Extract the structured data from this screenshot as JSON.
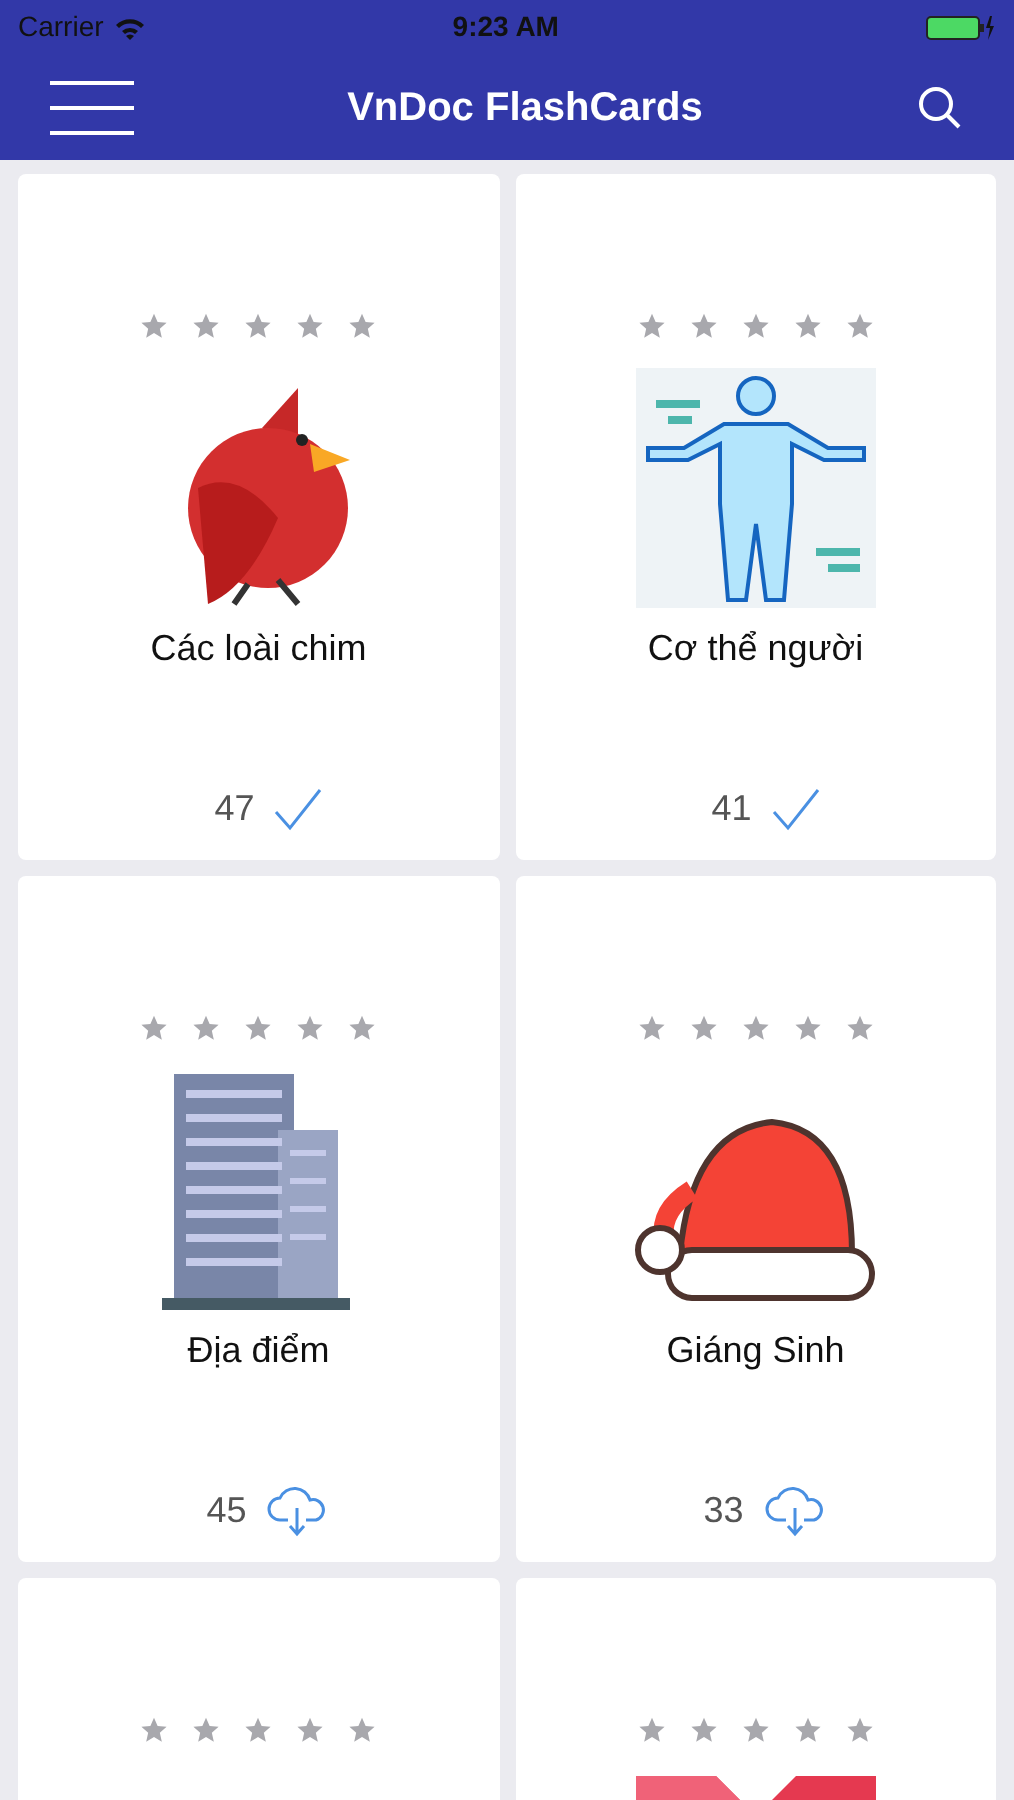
{
  "status_bar": {
    "carrier": "Carrier",
    "time": "9:23 AM"
  },
  "nav": {
    "title": "VnDoc FlashCards"
  },
  "cards": [
    {
      "kind": "bird",
      "stars": 0,
      "title": "Các loài chim",
      "count": "47",
      "downloaded": true
    },
    {
      "kind": "body",
      "stars": 0,
      "title": "Cơ thể người",
      "count": "41",
      "downloaded": true
    },
    {
      "kind": "building",
      "stars": 0,
      "title": "Địa điểm",
      "count": "45",
      "downloaded": false
    },
    {
      "kind": "hat",
      "stars": 0,
      "title": "Giáng Sinh",
      "count": "33",
      "downloaded": false
    },
    {
      "kind": "blank",
      "stars": 0
    },
    {
      "kind": "letter",
      "stars": 0
    }
  ]
}
